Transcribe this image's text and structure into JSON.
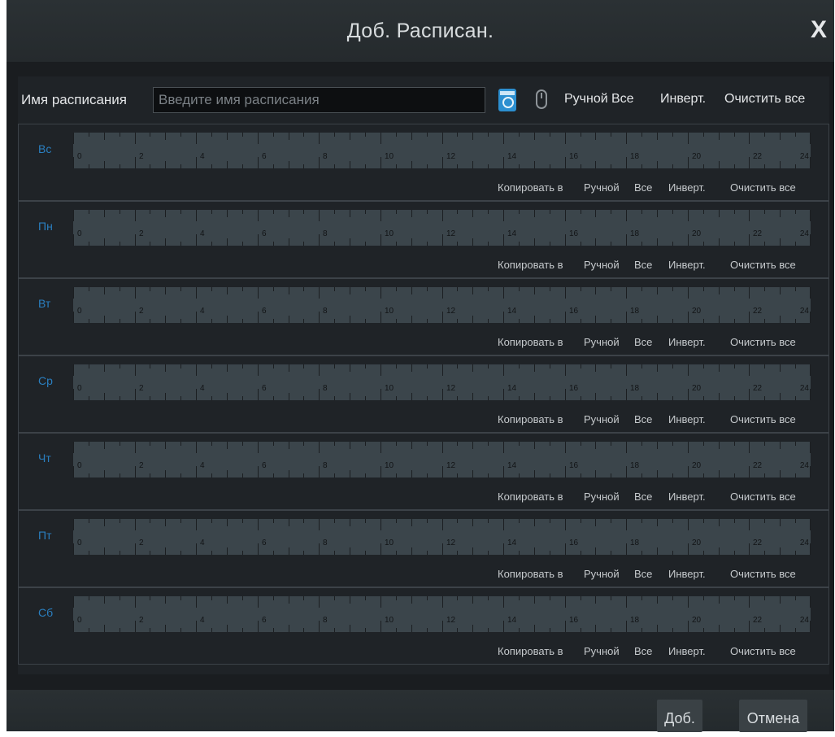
{
  "dialog": {
    "title": "Доб. Расписан.",
    "close_symbol": "X"
  },
  "name_row": {
    "label": "Имя расписания",
    "placeholder": "Введите имя расписания",
    "calendar_icon": "calendar-clock-icon",
    "mouse_icon": "mouse-icon",
    "actions": [
      "Ручной",
      "Все",
      "Инверт.",
      "Очистить все"
    ]
  },
  "timeline": {
    "hour_labels": [
      "0",
      "2",
      "4",
      "6",
      "8",
      "10",
      "12",
      "14",
      "16",
      "18",
      "20",
      "22",
      "24"
    ]
  },
  "days": [
    {
      "label": "Вс"
    },
    {
      "label": "Пн"
    },
    {
      "label": "Вт"
    },
    {
      "label": "Ср"
    },
    {
      "label": "Чт"
    },
    {
      "label": "Пт"
    },
    {
      "label": "Сб"
    }
  ],
  "row_actions": [
    "Копировать в",
    "Ручной",
    "Все",
    "Инверт.",
    "Очистить все"
  ],
  "footer": {
    "add_label": "Доб.",
    "cancel_label": "Отмена"
  },
  "colors": {
    "accent": "#2a7fc0",
    "timeline": "#3b454b",
    "background": "#1f2327"
  }
}
